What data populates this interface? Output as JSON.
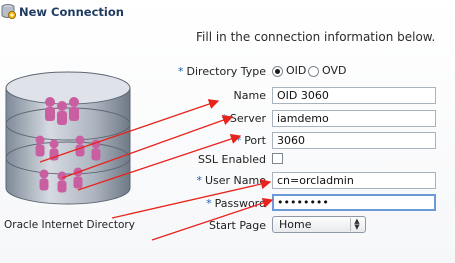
{
  "dialog": {
    "title": "New Connection",
    "instruction": "Fill in the connection information below."
  },
  "form": {
    "directory_type": {
      "label": "Directory Type",
      "options": [
        "OID",
        "OVD"
      ],
      "selected": "OID"
    },
    "name": {
      "label": "Name",
      "value": "OID 3060"
    },
    "server": {
      "label": "Server",
      "value": "iamdemo"
    },
    "port": {
      "label": "Port",
      "value": "3060"
    },
    "ssl_enabled": {
      "label": "SSL Enabled",
      "checked": false
    },
    "user_name": {
      "label": "User Name",
      "value": "cn=orcladmin"
    },
    "password": {
      "label": "Password",
      "value": "••••••••"
    },
    "start_page": {
      "label": "Start Page",
      "value": "Home"
    },
    "required_marker": "*"
  },
  "illustration": {
    "caption": "Oracle Internet Directory"
  },
  "colors": {
    "annotation_arrow": "#e8231b",
    "title_text": "#1f3a5f",
    "required_marker": "#1b5fb2",
    "focus_border": "#6b9ad8"
  }
}
